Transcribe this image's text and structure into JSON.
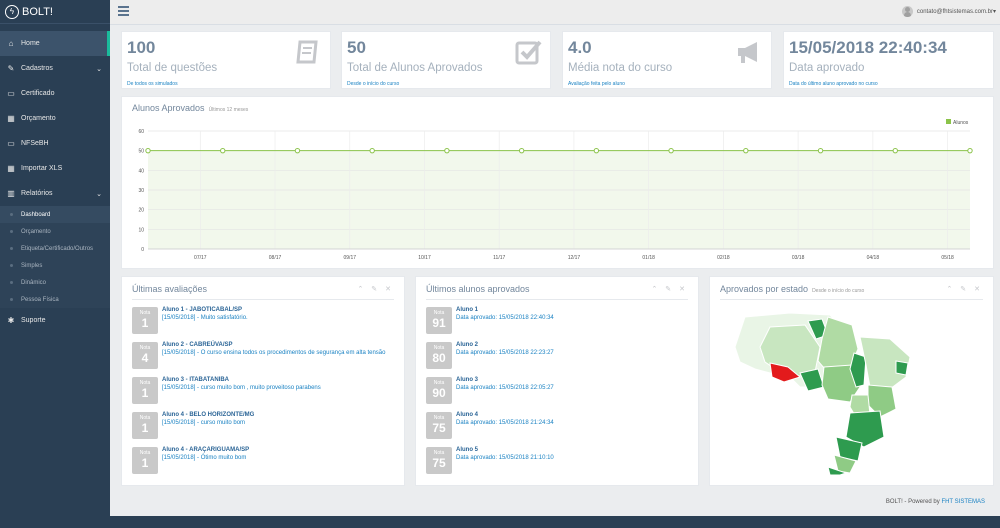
{
  "brand": {
    "name": "BOLT!"
  },
  "menu": [
    {
      "label": "Home",
      "icon": "home-icon",
      "glyph": "⌂",
      "active": true
    },
    {
      "label": "Cadastros",
      "icon": "edit-icon",
      "glyph": "✎",
      "chev": "⌄"
    },
    {
      "label": "Certificado",
      "icon": "certificate-icon",
      "glyph": "▭"
    },
    {
      "label": "Orçamento",
      "icon": "calculator-icon",
      "glyph": "▦"
    },
    {
      "label": "NFSeBH",
      "icon": "desktop-icon",
      "glyph": "▭"
    },
    {
      "label": "Importar XLS",
      "icon": "table-icon",
      "glyph": "▦"
    },
    {
      "label": "Relatórios",
      "icon": "bar-chart-icon",
      "glyph": "▥",
      "chev": "⌄",
      "open": true
    },
    {
      "label": "Suporte",
      "icon": "support-icon",
      "glyph": "✱"
    }
  ],
  "submenu": [
    {
      "label": "Dashboard",
      "active": true
    },
    {
      "label": "Orçamento"
    },
    {
      "label": "Etiqueta/Certificado/Outros"
    },
    {
      "label": "Simples"
    },
    {
      "label": "Dinâmico"
    },
    {
      "label": "Pessoa Física"
    }
  ],
  "topbar": {
    "user": "contato@fhtsistemas.com.br",
    "caret": "▾"
  },
  "stats": [
    {
      "value": "100",
      "label": "Total de questões",
      "sub": "De todos os simulados",
      "icon": "book-icon"
    },
    {
      "value": "50",
      "label": "Total de Alunos Aprovados",
      "sub": "Desde o início do curso",
      "icon": "check-square-icon"
    },
    {
      "value": "4.0",
      "label": "Média nota do curso",
      "sub": "Avaliação feita pelo aluno",
      "icon": "bullhorn-icon"
    },
    {
      "value": "15/05/2018 22:40:34",
      "label": "Data aprovado",
      "sub": "Data do último aluno aprovado no curso",
      "icon": ""
    }
  ],
  "chart_panel": {
    "title": "Alunos Aprovados",
    "subtitle": "Últimos 12 meses"
  },
  "chart_data": {
    "type": "line",
    "series": [
      {
        "name": "Alunos",
        "values": [
          50,
          50,
          50,
          50,
          50,
          50,
          50,
          50,
          50,
          50,
          50,
          50
        ]
      }
    ],
    "x_ticks": [
      "07/17",
      "08/17",
      "09/17",
      "10/17",
      "11/17",
      "12/17",
      "01/18",
      "02/18",
      "03/18",
      "04/18",
      "05/18"
    ],
    "y_ticks": [
      0,
      10,
      20,
      30,
      40,
      50,
      60
    ],
    "ylim": [
      0,
      60
    ],
    "legend": "top-right",
    "grid": true,
    "color": "#8bc34a"
  },
  "evaluations": {
    "title": "Últimas avaliações",
    "items": [
      {
        "label": "Nota",
        "nota": "1",
        "title": "Aluno 1 - JABOTICABAL/SP",
        "desc": "[15/05/2018] - Muito satisfatório."
      },
      {
        "label": "Nota",
        "nota": "4",
        "title": "Aluno 2 - CABREÚVA/SP",
        "desc": "[15/05/2018] - O curso ensina todos os procedimentos de segurança em alta tensão"
      },
      {
        "label": "Nota",
        "nota": "1",
        "title": "Aluno 3 - ITABATANIBA",
        "desc": "[15/05/2018] - curso muito bom , muito proveitoso parabens"
      },
      {
        "label": "Nota",
        "nota": "1",
        "title": "Aluno 4 - BELO HORIZONTE/MG",
        "desc": "[15/05/2018] - curso muito bom"
      },
      {
        "label": "Nota",
        "nota": "1",
        "title": "Aluno 4 - ARAÇARIGUAMA/SP",
        "desc": "[15/05/2018] - Ótimo muito bom"
      }
    ]
  },
  "approved": {
    "title": "Últimos alunos aprovados",
    "items": [
      {
        "label": "Nota",
        "nota": "91",
        "title": "Aluno 1",
        "desc": "Data aprovado: 15/05/2018 22:40:34"
      },
      {
        "label": "Nota",
        "nota": "80",
        "title": "Aluno 2",
        "desc": "Data aprovado: 15/05/2018 22:23:27"
      },
      {
        "label": "Nota",
        "nota": "90",
        "title": "Aluno 3",
        "desc": "Data aprovado: 15/05/2018 22:05:27"
      },
      {
        "label": "Nota",
        "nota": "75",
        "title": "Aluno 4",
        "desc": "Data aprovado: 15/05/2018 21:24:34"
      },
      {
        "label": "Nota",
        "nota": "75",
        "title": "Aluno 5",
        "desc": "Data aprovado: 15/05/2018 21:10:10"
      }
    ]
  },
  "map_panel": {
    "title": "Aprovados por estado",
    "subtitle": "Desde o início do curso"
  },
  "panel_controls": "⌃ ✎ ✕",
  "footer": {
    "text": "BOLT! - Powered by",
    "link": "FHT SISTEMAS"
  }
}
